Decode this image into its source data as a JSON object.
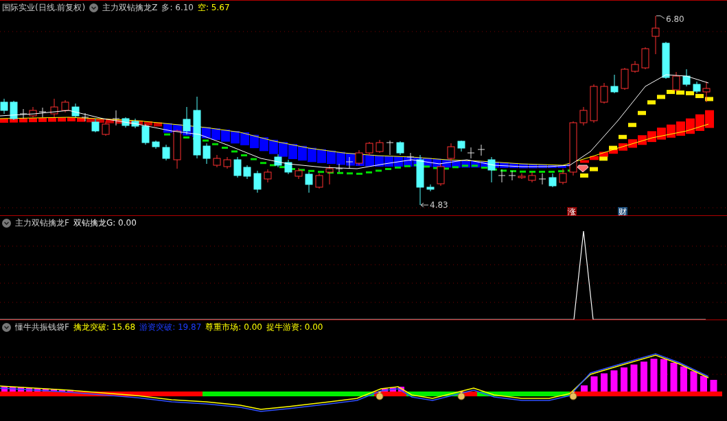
{
  "main_pane": {
    "stock_title": "国际实业(日线.前复权)",
    "indicator_name": "主力双钻擒龙Z",
    "readouts": [
      {
        "text": "多: 6.10",
        "color": "#c8c8c8"
      },
      {
        "text": "空: 5.67",
        "color": "#ffff00"
      }
    ],
    "high_label": "6.80",
    "low_label": "4.83",
    "markers": [
      {
        "text": "涨",
        "color": "#8b0000"
      },
      {
        "text": "财",
        "color": "#1f4e7a"
      }
    ]
  },
  "signal_pane": {
    "indicator_name": "主力双钻擒龙F",
    "readouts": [
      {
        "text": "双钻擒龙G: 0.00",
        "color": "#e8e8e8"
      }
    ]
  },
  "money_pane": {
    "indicator_name": "懂牛共振钱袋F",
    "readouts": [
      {
        "text": "擒龙突破: 15.68",
        "color": "#ffff00"
      },
      {
        "text": "游资突破: 19.87",
        "color": "#1e3cff"
      },
      {
        "text": "尊重市场: 0.00",
        "color": "#ffff00"
      },
      {
        "text": "捉牛游资: 0.00",
        "color": "#ffff00"
      }
    ]
  }
}
